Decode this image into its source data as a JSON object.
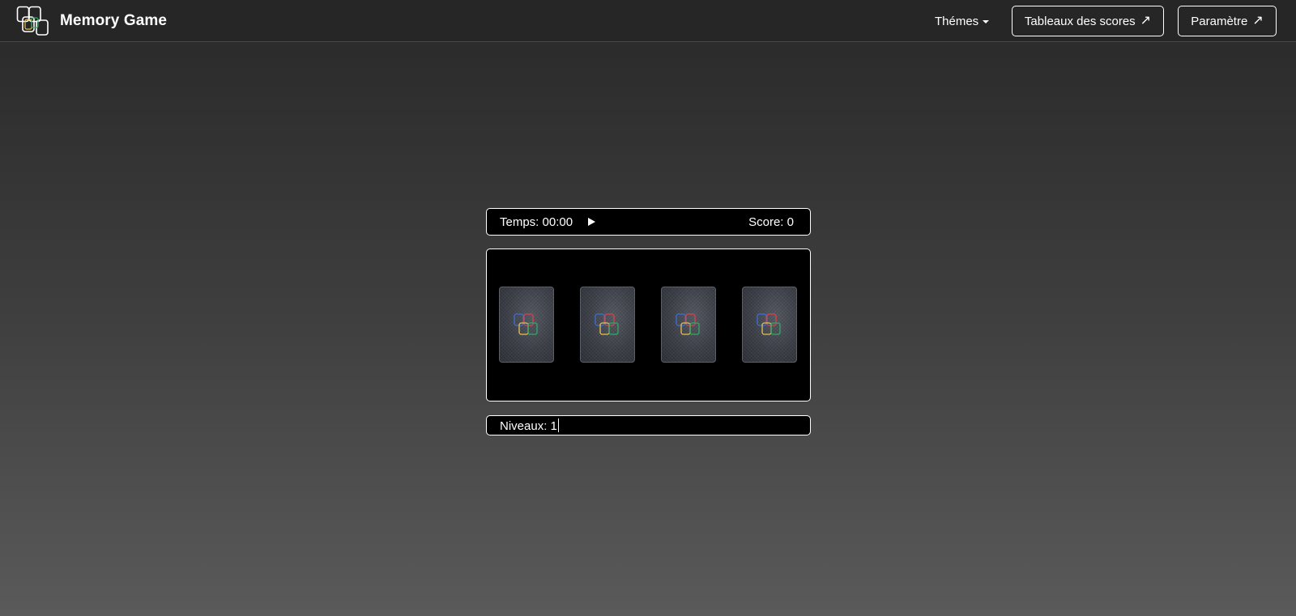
{
  "header": {
    "brand_title": "Memory Game",
    "logo_icon": "cards-logo-icon",
    "nav": {
      "themes_label": "Thémes",
      "scores_label": "Tableaux des scores",
      "params_label": "Paramètre",
      "external_icon": "↗"
    }
  },
  "game": {
    "time_label": "Temps: 00:00",
    "score_label": "Score: 0",
    "play_icon": "play-icon",
    "level_label": "Niveaux: 1",
    "cards_face_down": 4
  },
  "colors": {
    "logo_blue": "#3b6fd8",
    "logo_red": "#d9424a",
    "logo_yellow": "#e8c24a",
    "logo_green": "#33a866",
    "panel_bg": "#000000",
    "border": "#ffffff"
  }
}
